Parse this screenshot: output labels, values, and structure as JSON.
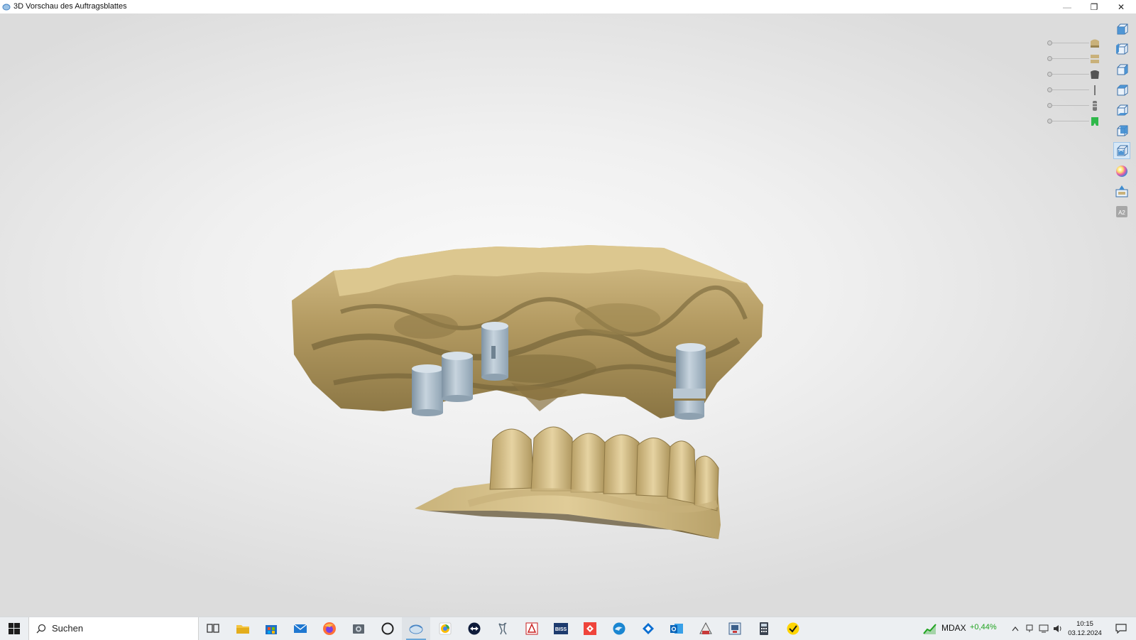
{
  "window": {
    "title": "3D Vorschau des Auftragsblattes",
    "controls": {
      "minimize": "—",
      "maximize": "❐",
      "close": "✕"
    }
  },
  "viewer": {
    "visibility_sliders": [
      {
        "name": "antagonist-model",
        "icon": "antagonist-model-icon",
        "color": "#c9b17a"
      },
      {
        "name": "jaw-model",
        "icon": "jaw-model-icon",
        "color": "#c9b17a"
      },
      {
        "name": "gingiva-mask",
        "icon": "gingiva-icon",
        "color": "#555555"
      },
      {
        "name": "scanbody",
        "icon": "scanbody-icon",
        "color": "#777777"
      },
      {
        "name": "implant",
        "icon": "implant-icon",
        "color": "#777777"
      },
      {
        "name": "selected-element",
        "icon": "green-tooth-icon",
        "color": "#2fb84a"
      }
    ],
    "toolbar": [
      {
        "name": "view-front",
        "icon": "cube-front-icon",
        "active": false
      },
      {
        "name": "view-left",
        "icon": "cube-left-icon",
        "active": false
      },
      {
        "name": "view-right",
        "icon": "cube-right-icon",
        "active": false
      },
      {
        "name": "view-top",
        "icon": "cube-top-icon",
        "active": false
      },
      {
        "name": "view-bottom",
        "icon": "cube-bottom-icon",
        "active": false
      },
      {
        "name": "view-back",
        "icon": "cube-back-icon",
        "active": false
      },
      {
        "name": "view-occlusal",
        "icon": "cube-occlusal-icon",
        "active": true
      },
      {
        "name": "color-toggle",
        "icon": "color-sphere-icon",
        "active": false
      },
      {
        "name": "snapshot",
        "icon": "screenshot-icon",
        "active": false
      },
      {
        "name": "tooth-shade",
        "icon": "shade-label-icon",
        "label": "A2",
        "active": false
      }
    ],
    "colors": {
      "stone": "#c4ad7a",
      "stone_shadow": "#7d6a3e",
      "scanbody": "#a9b9c6"
    }
  },
  "taskbar": {
    "search_placeholder": "Suchen",
    "apps": [
      {
        "name": "task-view",
        "icon": "task-view-icon"
      },
      {
        "name": "file-explorer",
        "icon": "folder-icon"
      },
      {
        "name": "microsoft-store",
        "icon": "store-icon"
      },
      {
        "name": "mail",
        "icon": "mail-icon"
      },
      {
        "name": "firefox",
        "icon": "firefox-icon"
      },
      {
        "name": "photos",
        "icon": "camera-icon"
      },
      {
        "name": "cortana",
        "icon": "circle-icon"
      },
      {
        "name": "exocad",
        "icon": "exocad-icon",
        "active": true
      },
      {
        "name": "chrome",
        "icon": "chrome-icon"
      },
      {
        "name": "teamviewer",
        "icon": "teamviewer-icon"
      },
      {
        "name": "dental-app",
        "icon": "tooth-app-icon"
      },
      {
        "name": "acrobat",
        "icon": "acrobat-icon"
      },
      {
        "name": "biss",
        "icon": "biss-icon",
        "label": "BISS"
      },
      {
        "name": "anydesk",
        "icon": "anydesk-icon"
      },
      {
        "name": "edge",
        "icon": "edge-icon"
      },
      {
        "name": "dropbox",
        "icon": "dropbox-icon"
      },
      {
        "name": "outlook",
        "icon": "outlook-icon"
      },
      {
        "name": "dental-lab",
        "icon": "lab-icon"
      },
      {
        "name": "remote-desktop",
        "icon": "remote-icon"
      },
      {
        "name": "calculator",
        "icon": "calculator-icon"
      },
      {
        "name": "norton",
        "icon": "norton-icon"
      }
    ],
    "stock": {
      "name": "MDAX",
      "change": "+0,44%"
    },
    "clock": {
      "time": "10:15",
      "date": "03.12.2024"
    }
  }
}
